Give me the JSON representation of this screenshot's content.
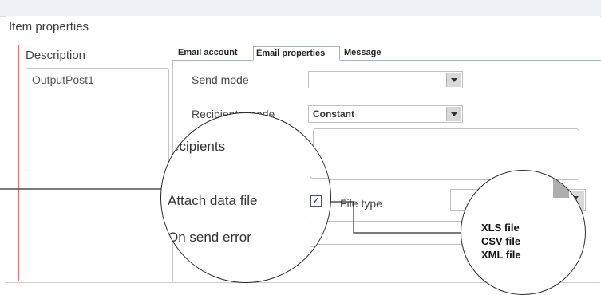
{
  "panel": {
    "title": "Item properties"
  },
  "description": {
    "label": "Description",
    "value": "OutputPost1"
  },
  "tabs": [
    {
      "label": "Email account"
    },
    {
      "label": "Email properties"
    },
    {
      "label": "Message"
    }
  ],
  "form": {
    "send_mode": {
      "label": "Send mode",
      "value": ""
    },
    "recipients_mode": {
      "label": "Recipients mode",
      "value": "Constant"
    },
    "recipients": {
      "label": "ecipients"
    },
    "attach_data_file": {
      "label": "Attach data file",
      "checked": true,
      "check_glyph": "✓"
    },
    "file_type": {
      "label": "File type"
    },
    "on_send_error": {
      "label": "On send error"
    }
  },
  "file_type_options": [
    "XLS file",
    "CSV file",
    "XML file"
  ]
}
